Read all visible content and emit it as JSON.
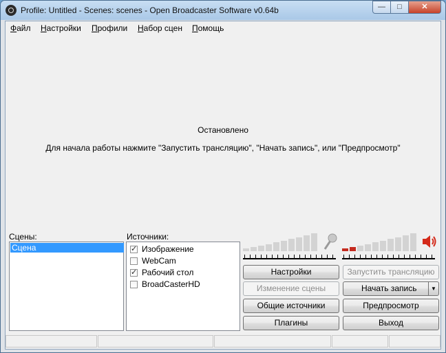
{
  "window": {
    "title": "Profile: Untitled - Scenes: scenes - Open Broadcaster Software v0.64b"
  },
  "menu": [
    {
      "label": "Файл"
    },
    {
      "label": "Настройки"
    },
    {
      "label": "Профили"
    },
    {
      "label": "Набор сцен"
    },
    {
      "label": "Помощь"
    }
  ],
  "preview": {
    "status": "Остановлено",
    "hint": "Для начала работы нажмите \"Запустить трансляцию\", \"Начать запись\", или \"Предпросмотр\""
  },
  "scenes": {
    "label": "Сцены:",
    "items": [
      "Сцена"
    ],
    "selected": "Сцена"
  },
  "sources": {
    "label": "Источники:",
    "items": [
      {
        "name": "Изображение",
        "checked": true
      },
      {
        "name": "WebCam",
        "checked": false
      },
      {
        "name": "Рабочий стол",
        "checked": true
      },
      {
        "name": "BroadCasterHD",
        "checked": false
      }
    ]
  },
  "meters": {
    "mic": {
      "icon": "microphone-icon",
      "level": 0.0
    },
    "desktop": {
      "icon": "speaker-icon",
      "level": 0.15,
      "level_color": "#c42a1e"
    }
  },
  "buttons": {
    "settings": "Настройки",
    "start_stream": "Запустить трансляцию",
    "scene_edit": "Изменение сцены",
    "start_record": "Начать запись",
    "global_sources": "Общие источники",
    "preview": "Предпросмотр",
    "plugins": "Плагины",
    "exit": "Выход"
  },
  "colors": {
    "selection": "#3399ff",
    "speaker": "#d42a1a"
  }
}
